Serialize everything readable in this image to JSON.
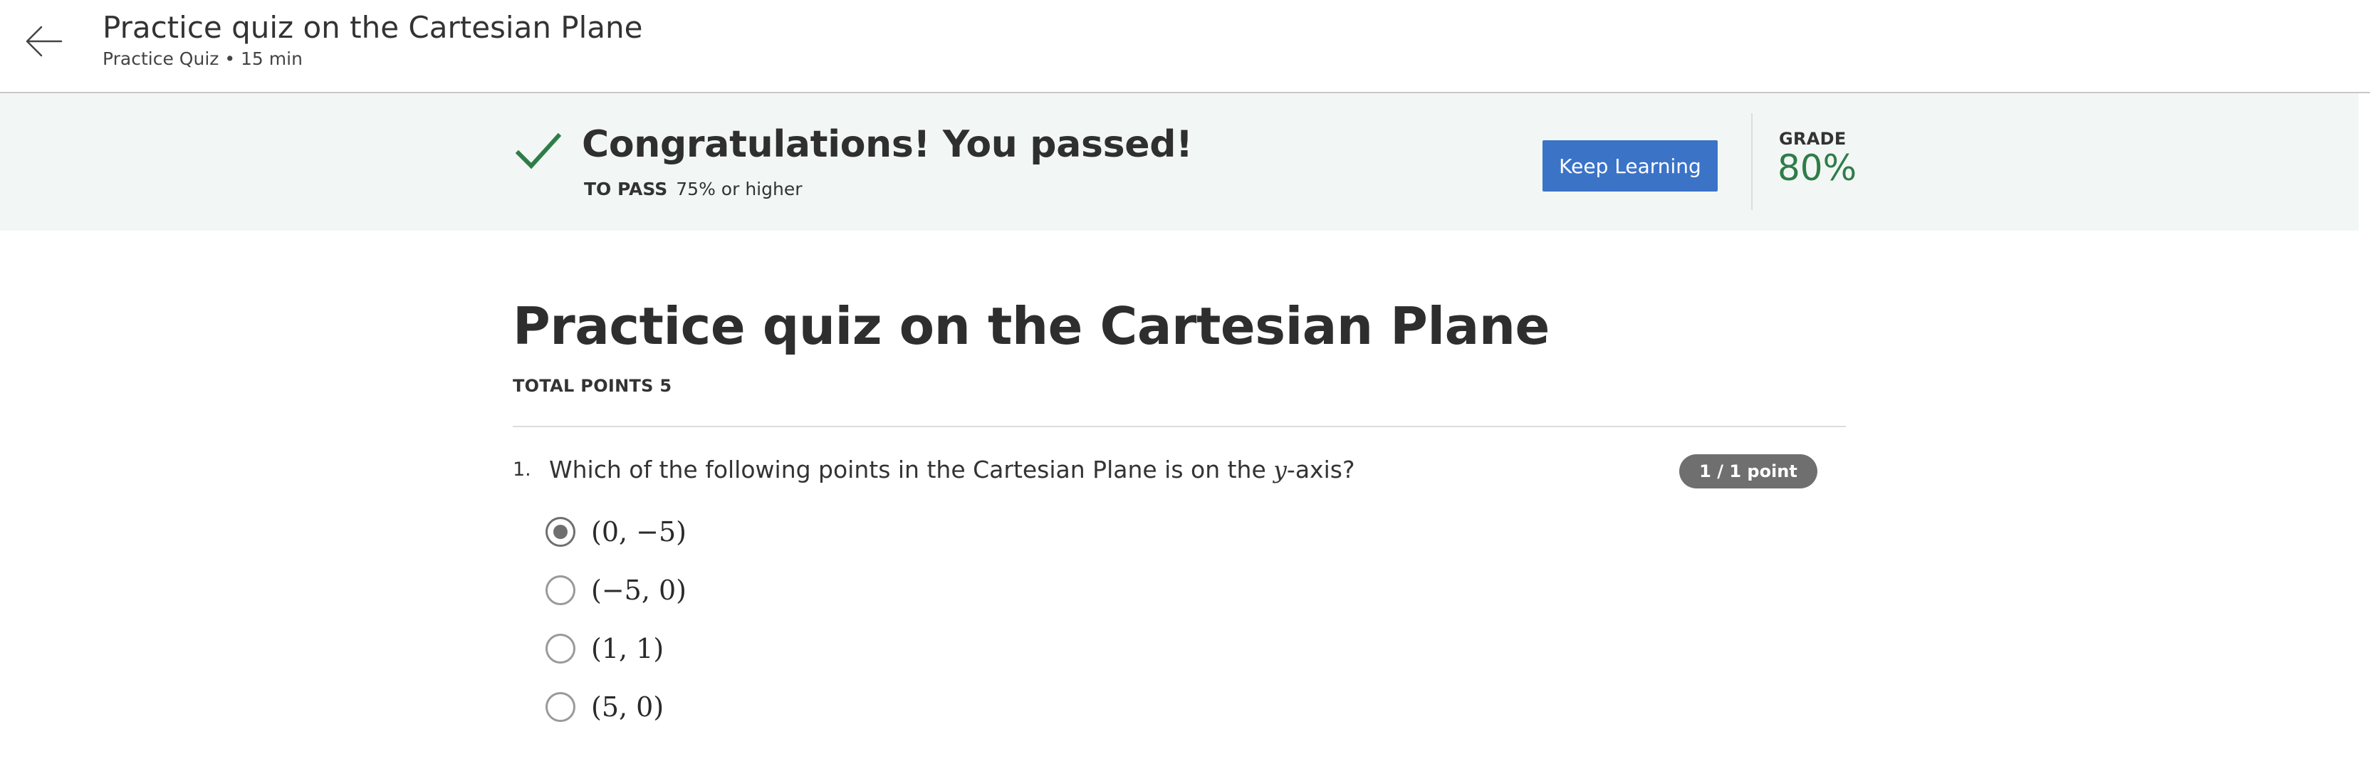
{
  "header": {
    "title": "Practice quiz on the Cartesian Plane",
    "subtitle": "Practice Quiz • 15 min"
  },
  "banner": {
    "message": "Congratulations! You passed!",
    "to_pass_label": "TO PASS",
    "to_pass_value": "75% or higher",
    "keep_learning_label": "Keep Learning",
    "grade_label": "GRADE",
    "grade_value": "80%"
  },
  "quiz": {
    "title": "Practice quiz on the Cartesian Plane",
    "total_points": "TOTAL POINTS 5",
    "questions": [
      {
        "number": "1.",
        "text_before": "Which of the following points in the Cartesian Plane is on the ",
        "variable": "y",
        "text_after": "-axis?",
        "points": "1 / 1 point",
        "options": [
          {
            "label": "(0, −5)",
            "selected": true
          },
          {
            "label": "(−5, 0)",
            "selected": false
          },
          {
            "label": "(1, 1)",
            "selected": false
          },
          {
            "label": "(5, 0)",
            "selected": false
          }
        ]
      }
    ]
  },
  "colors": {
    "banner_bg": "#f2f7f6",
    "button_blue": "#3b73c7",
    "grade_green": "#2e7d47",
    "badge_gray": "#6f6f6f"
  },
  "icons": {
    "back": "arrow-left-icon",
    "check": "checkmark-icon"
  }
}
